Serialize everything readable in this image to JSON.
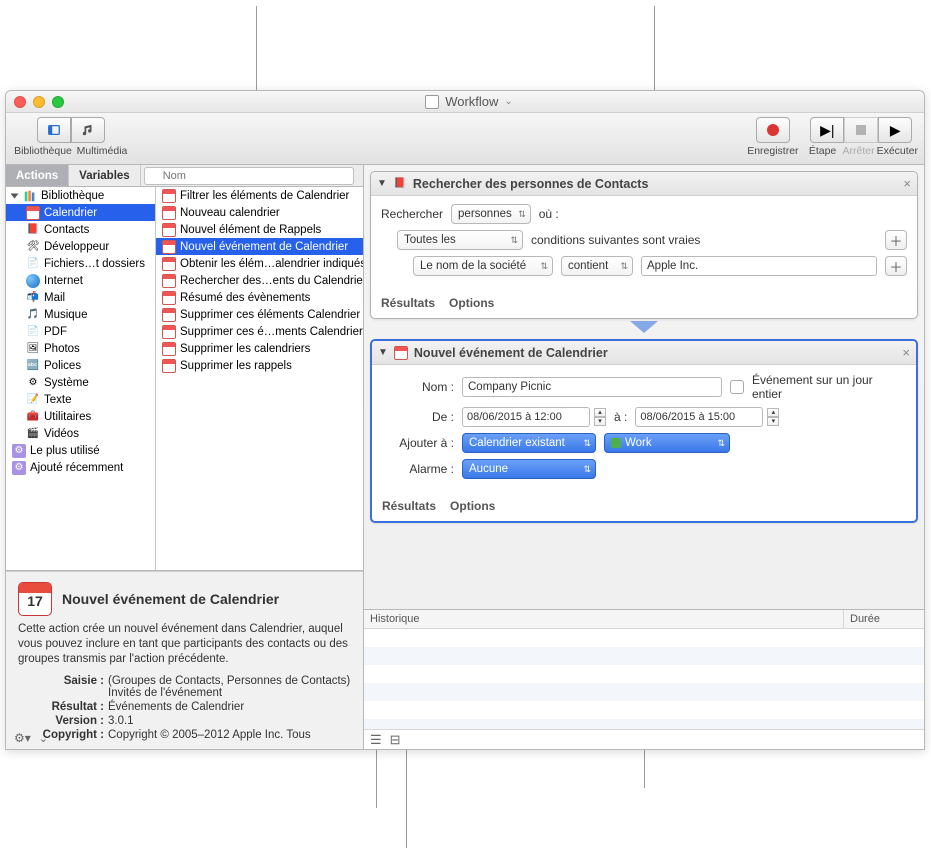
{
  "window": {
    "title": "Workflow"
  },
  "toolbar": {
    "library": "Bibliothèque",
    "media": "Multimédia",
    "record": "Enregistrer",
    "step": "Étape",
    "stop": "Arrêter",
    "run": "Exécuter"
  },
  "tabs": {
    "actions": "Actions",
    "variables": "Variables"
  },
  "search": {
    "placeholder": "Nom"
  },
  "library": {
    "root": "Bibliothèque",
    "categories": [
      "Calendrier",
      "Contacts",
      "Développeur",
      "Fichiers…t dossiers",
      "Internet",
      "Mail",
      "Musique",
      "PDF",
      "Photos",
      "Polices",
      "Système",
      "Texte",
      "Utilitaires",
      "Vidéos"
    ],
    "smart1": "Le plus utilisé",
    "smart2": "Ajouté récemment"
  },
  "actions_list": [
    "Filtrer les éléments de Calendrier",
    "Nouveau calendrier",
    "Nouvel élément de Rappels",
    "Nouvel événement de Calendrier",
    "Obtenir les élém…alendrier indiqués",
    "Rechercher des…ents du Calendrier",
    "Résumé des évènements",
    "Supprimer ces éléments Calendrier",
    "Supprimer ces é…ments Calendrier",
    "Supprimer les calendriers",
    "Supprimer les rappels"
  ],
  "actions_selected_index": 3,
  "description": {
    "title": "Nouvel événement de Calendrier",
    "text": "Cette action crée un nouvel événement dans Calendrier, auquel vous pouvez inclure en tant que participants des contacts ou des groupes transmis par l'action précédente.",
    "k_input": "Saisie :",
    "v_input": "(Groupes de Contacts, Personnes de Contacts) Invités de l'événement",
    "k_result": "Résultat :",
    "v_result": "Événements de Calendrier",
    "k_version": "Version :",
    "v_version": "3.0.1",
    "k_copy": "Copyright :",
    "v_copy": "Copyright © 2005–2012 Apple Inc. Tous"
  },
  "wf_action1": {
    "title": "Rechercher des personnes de Contacts",
    "l_find": "Rechercher",
    "v_find": "personnes",
    "l_where": "où :",
    "v_scope": "Toutes les",
    "t_cond": "conditions suivantes sont vraies",
    "v_field": "Le nom de la société",
    "v_op": "contient",
    "v_value": "Apple Inc.",
    "results": "Résultats",
    "options": "Options"
  },
  "wf_action2": {
    "title": "Nouvel événement de Calendrier",
    "l_name": "Nom :",
    "v_name": "Company Picnic",
    "allday": "Événement sur un jour entier",
    "l_from": "De :",
    "v_from": "08/06/2015 à 12:00",
    "l_to": "à :",
    "v_to": "08/06/2015 à 15:00",
    "l_addto": "Ajouter à :",
    "v_addto": "Calendrier existant",
    "v_cal": "Work",
    "l_alarm": "Alarme :",
    "v_alarm": "Aucune",
    "results": "Résultats",
    "options": "Options"
  },
  "log": {
    "h1": "Historique",
    "h2": "Durée"
  }
}
